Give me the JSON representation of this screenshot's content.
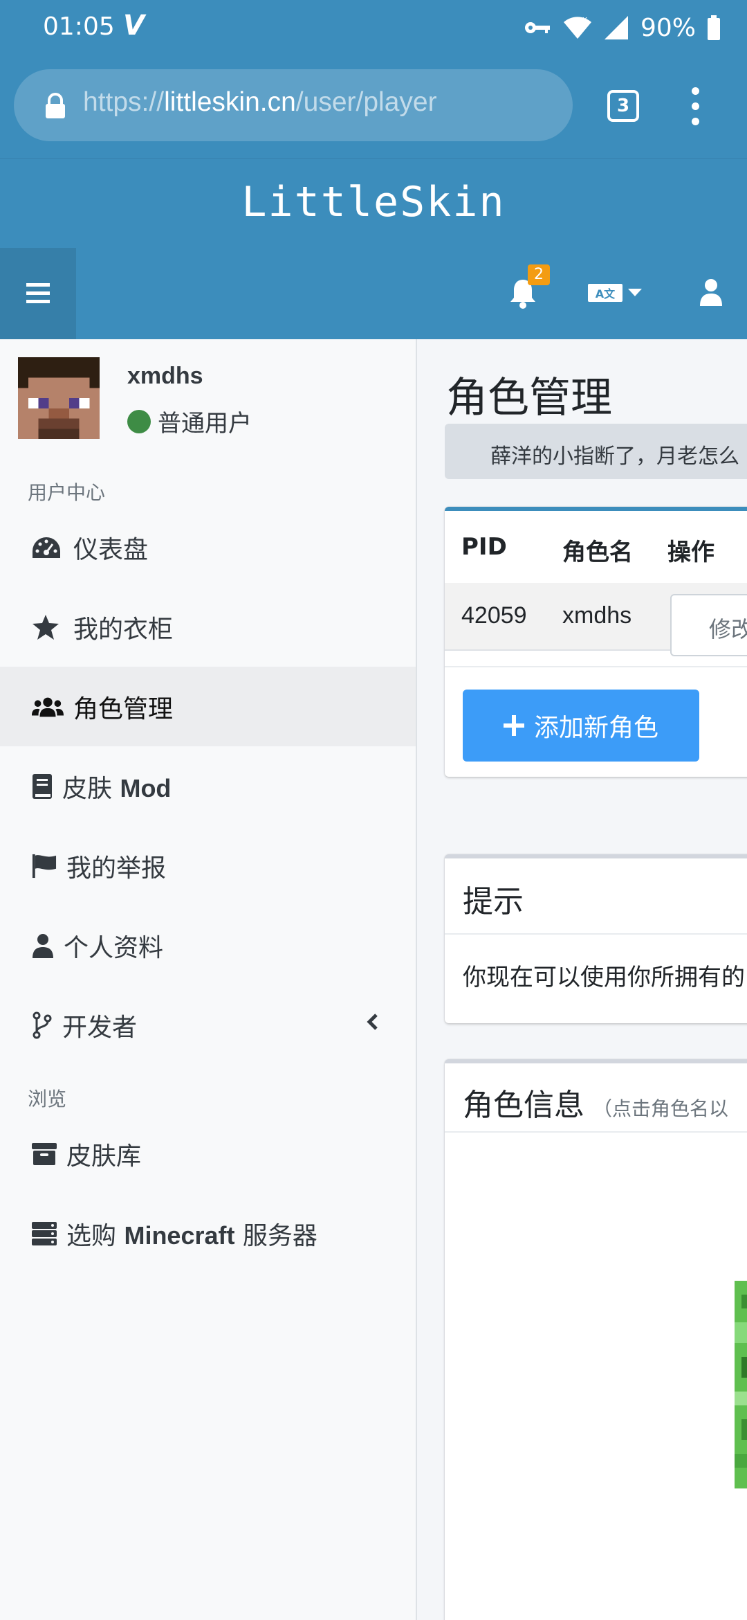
{
  "status_bar": {
    "time": "01:05",
    "carrier_glyph": "V",
    "battery": "90%",
    "icons": [
      "key-icon",
      "wifi-icon",
      "signal-icon",
      "battery-icon"
    ]
  },
  "browser": {
    "url_scheme": "https://",
    "url_host": "littleskin.cn",
    "url_path": "/user/player",
    "tab_count": "3"
  },
  "header": {
    "logo": "LittleSkin",
    "notification_count": "2",
    "lang_label": "A文"
  },
  "sidebar": {
    "user": {
      "name": "xmdhs",
      "role": "普通用户"
    },
    "sections": [
      {
        "title": "用户中心",
        "items": [
          {
            "label": "仪表盘",
            "icon": "tachometer-icon"
          },
          {
            "label": "我的衣柜",
            "icon": "star-icon"
          },
          {
            "label": "角色管理",
            "icon": "users-icon",
            "active": true
          },
          {
            "label": "皮肤 ",
            "label_bold": "Mod",
            "icon": "book-icon"
          },
          {
            "label": "我的举报",
            "icon": "flag-icon"
          },
          {
            "label": "个人资料",
            "icon": "user-icon"
          },
          {
            "label": "开发者",
            "icon": "code-branch-icon"
          }
        ]
      },
      {
        "title": "浏览",
        "items": [
          {
            "label": "皮肤库",
            "icon": "archive-icon"
          },
          {
            "label": "选购 ",
            "label_bold": "Minecraft",
            "label_after": " 服务器",
            "icon": "server-icon"
          }
        ]
      }
    ]
  },
  "main": {
    "page_title": "角色管理",
    "announcement": "薛洋的小指断了，月老怎么",
    "players_table": {
      "columns": [
        "PID",
        "角色名",
        "操作"
      ],
      "rows": [
        {
          "pid": "42059",
          "name": "xmdhs",
          "action": "修改"
        }
      ]
    },
    "add_button": "添加新角色",
    "tip_card": {
      "title": "提示",
      "body": "你现在可以使用你所拥有的"
    },
    "info_card": {
      "title": "角色信息",
      "subtitle": "（点击角色名以"
    }
  },
  "colors": {
    "primary": "#3c8dbc",
    "button_blue": "#3c9cf8",
    "badge": "#f39c12",
    "online_dot": "#3e8c45"
  }
}
